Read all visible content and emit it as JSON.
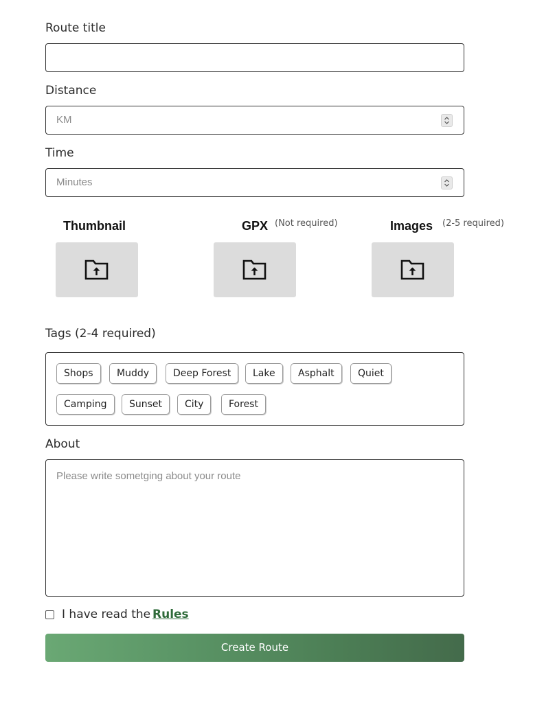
{
  "form": {
    "route_title": {
      "label": "Route title",
      "value": "",
      "placeholder": ""
    },
    "distance": {
      "label": "Distance",
      "value": "",
      "placeholder": "KM"
    },
    "time": {
      "label": "Time",
      "value": "",
      "placeholder": "Minutes"
    }
  },
  "uploads": {
    "thumbnail": {
      "title": "Thumbnail",
      "note": "",
      "icon": "folder-upload-icon"
    },
    "gpx": {
      "title": "GPX",
      "note": "(Not required)",
      "icon": "folder-upload-icon"
    },
    "images": {
      "title": "Images",
      "note": "(2-5 required)",
      "icon": "folder-upload-icon"
    }
  },
  "tags": {
    "label": "Tags (2-4 required)",
    "items": [
      "Shops",
      "Muddy",
      "Deep Forest",
      "Lake",
      "Asphalt",
      "Quiet",
      "Camping",
      "Sunset",
      "City",
      "Forest"
    ]
  },
  "about": {
    "label": "About",
    "placeholder": "Please write sometging about your route",
    "value": ""
  },
  "agreement": {
    "checked": false,
    "text": "I have read the",
    "link_label": "Rules"
  },
  "submit_label": "Create Route",
  "colors": {
    "accent_green": "#2f6b3a",
    "button_gradient_start": "#6aa874",
    "button_gradient_end": "#446b4b",
    "upload_box_bg": "#dcdcdc"
  }
}
